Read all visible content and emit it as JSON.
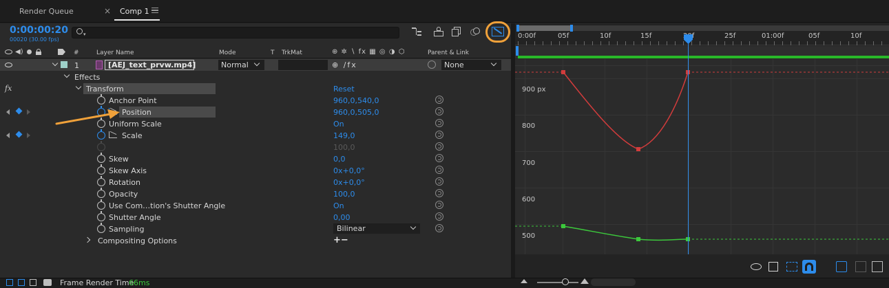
{
  "tabs": [
    {
      "label": "Render Queue"
    },
    {
      "label": "Comp 1"
    }
  ],
  "timecode": {
    "value": "0:00:00:20",
    "sub": "00020 (30.00 fps)"
  },
  "search": {
    "placeholder": ""
  },
  "columns": {
    "layer_name": "Layer Name",
    "mode": "Mode",
    "t": "T",
    "trkmat": "TrkMat",
    "parent_link": "Parent & Link",
    "hash": "#"
  },
  "layer": {
    "number": "1",
    "name": "[AEJ_text_prvw.mp4]",
    "mode": "Normal",
    "parent": "None"
  },
  "properties": {
    "effects": "Effects",
    "transform": "Transform",
    "reset": "Reset",
    "fx": "fx",
    "anchor_point": {
      "label": "Anchor Point",
      "value": "960,0,540,0"
    },
    "position": {
      "label": "Position",
      "value": "960,0,505,0"
    },
    "uniform_scale": {
      "label": "Uniform Scale",
      "value": "On"
    },
    "scale": {
      "label": "Scale",
      "value": "149,0"
    },
    "scale_disabled": {
      "value": "100,0"
    },
    "skew": {
      "label": "Skew",
      "value": "0,0"
    },
    "skew_axis": {
      "label": "Skew Axis",
      "value": "0x+0,0°"
    },
    "rotation": {
      "label": "Rotation",
      "value": "0x+0,0°"
    },
    "opacity": {
      "label": "Opacity",
      "value": "100,0"
    },
    "use_comp_shutter": {
      "label": "Use Com…tion's Shutter Angle",
      "value": "On"
    },
    "shutter_angle": {
      "label": "Shutter Angle",
      "value": "0,00"
    },
    "sampling": {
      "label": "Sampling",
      "value": "Bilinear"
    },
    "compositing": {
      "label": "Compositing Options",
      "value": "+−"
    }
  },
  "ruler": {
    "labels": [
      "0:00f",
      "05f",
      "10f",
      "15f",
      "20f",
      "25f",
      "01:00f",
      "05f",
      "10f"
    ]
  },
  "graph": {
    "y_labels": [
      "900 px",
      "800",
      "700",
      "600",
      "500"
    ]
  },
  "status": {
    "label": "Frame Render Time",
    "value": "66ms"
  },
  "colors": {
    "accent": "#2d8ceb",
    "highlight_ring": "#f0a13a",
    "curve_red": "#d23c3c",
    "curve_green": "#3cc83c",
    "arrow": "#f0a13a"
  }
}
